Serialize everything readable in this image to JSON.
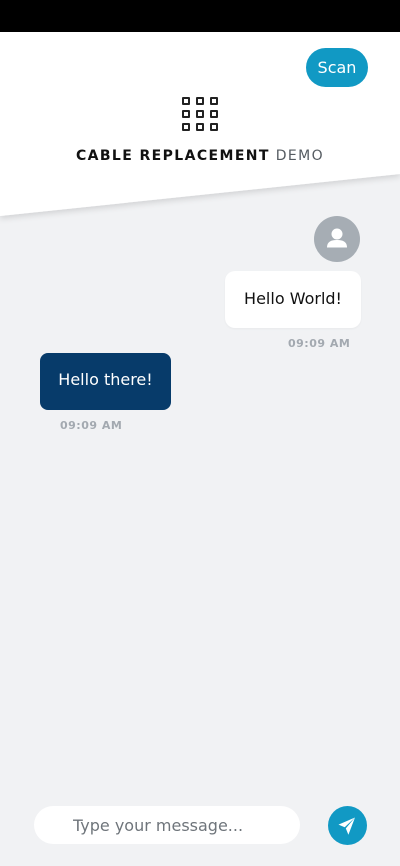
{
  "header": {
    "scan_label": "Scan",
    "title_bold": "CABLE REPLACEMENT",
    "title_light": "DEMO",
    "logo_icon": "grid-icon"
  },
  "messages": [
    {
      "direction": "sent",
      "text": "Hello World!",
      "time": "09:09 AM",
      "avatar_icon": "user-icon"
    },
    {
      "direction": "received",
      "text": "Hello there!",
      "time": "09:09 AM"
    }
  ],
  "composer": {
    "placeholder": "Type your message...",
    "value": "",
    "send_icon": "send-icon"
  },
  "colors": {
    "accent": "#1199c4",
    "received_bubble": "#073b6a",
    "sent_bubble": "#ffffff",
    "background": "#f1f2f4",
    "timestamp": "#a3a9b0",
    "avatar": "#a6adb4"
  }
}
